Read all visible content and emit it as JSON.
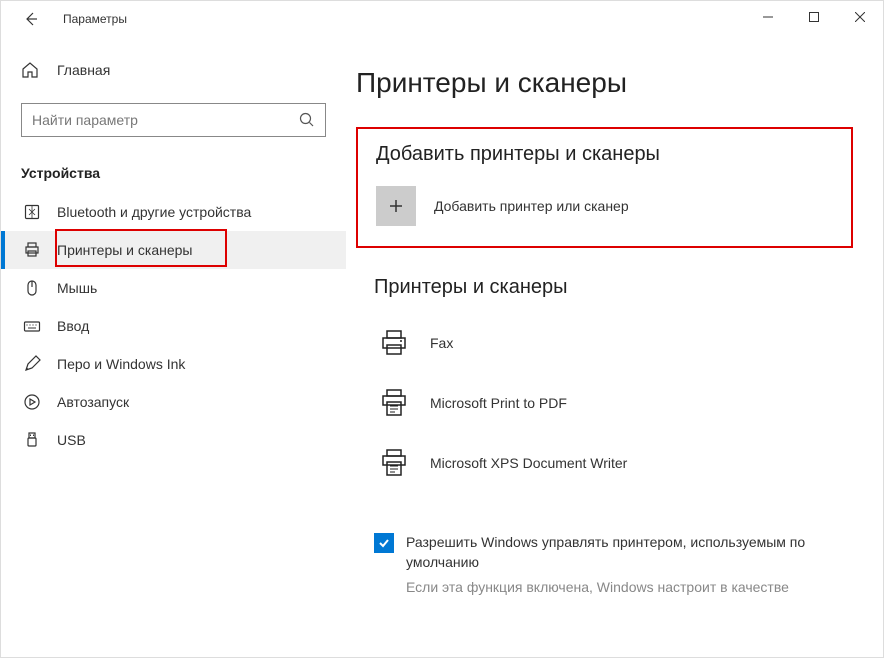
{
  "window": {
    "title": "Параметры"
  },
  "sidebar": {
    "home_label": "Главная",
    "search_placeholder": "Найти параметр",
    "category": "Устройства",
    "items": [
      {
        "label": "Bluetooth и другие устройства"
      },
      {
        "label": "Принтеры и сканеры"
      },
      {
        "label": "Мышь"
      },
      {
        "label": "Ввод"
      },
      {
        "label": "Перо и Windows Ink"
      },
      {
        "label": "Автозапуск"
      },
      {
        "label": "USB"
      }
    ]
  },
  "main": {
    "title": "Принтеры и сканеры",
    "add_section_title": "Добавить принтеры и сканеры",
    "add_button_label": "Добавить принтер или сканер",
    "list_section_title": "Принтеры и сканеры",
    "devices": [
      {
        "label": "Fax"
      },
      {
        "label": "Microsoft Print to PDF"
      },
      {
        "label": "Microsoft XPS Document Writer"
      }
    ],
    "checkbox_label": "Разрешить Windows управлять принтером, используемым по умолчанию",
    "hint": "Если эта функция включена, Windows настроит в качестве"
  }
}
